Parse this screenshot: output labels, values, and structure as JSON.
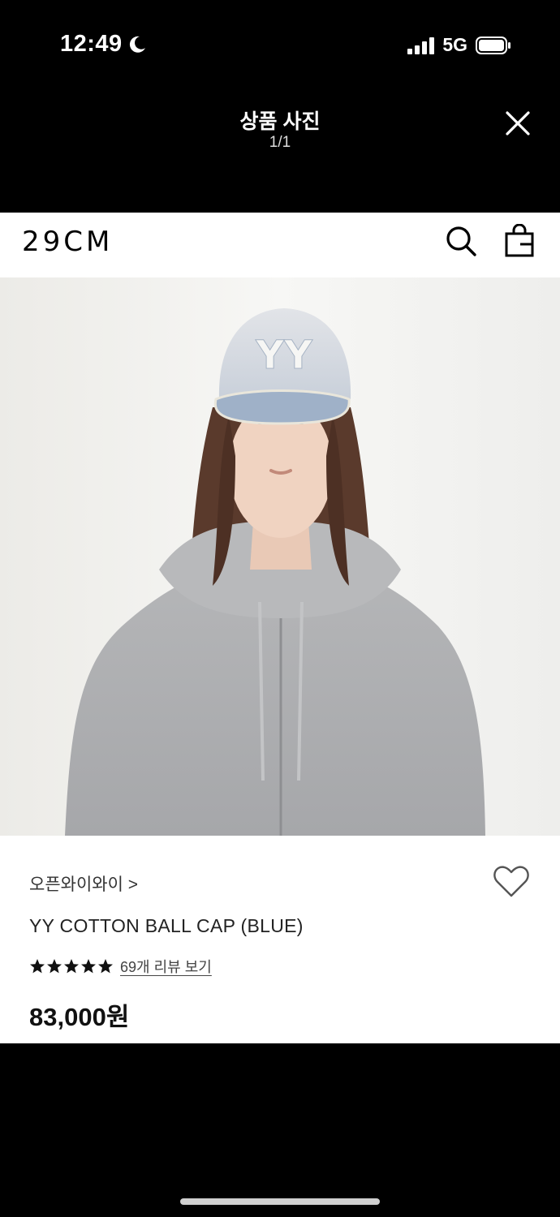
{
  "status_bar": {
    "time": "12:49",
    "network": "5G",
    "icons": [
      "moon-icon",
      "signal-icon",
      "battery-icon"
    ]
  },
  "viewer": {
    "title": "상품 사진",
    "counter": "1/1",
    "close_icon": "close-icon"
  },
  "app_header": {
    "logo": "29CM",
    "icons": [
      "search-icon",
      "shopping-bag-icon"
    ]
  },
  "product": {
    "brand": "오픈와이와이 >",
    "name": "YY COTTON BALL CAP (BLUE)",
    "rating_stars": 5,
    "review_link": "69개 리뷰 보기",
    "price": "83,000원",
    "wishlist_icon": "heart-icon",
    "photo_text": "YY"
  },
  "colors": {
    "background": "#000000",
    "card": "#ffffff",
    "text_primary": "#111111",
    "text_secondary": "#444444"
  }
}
